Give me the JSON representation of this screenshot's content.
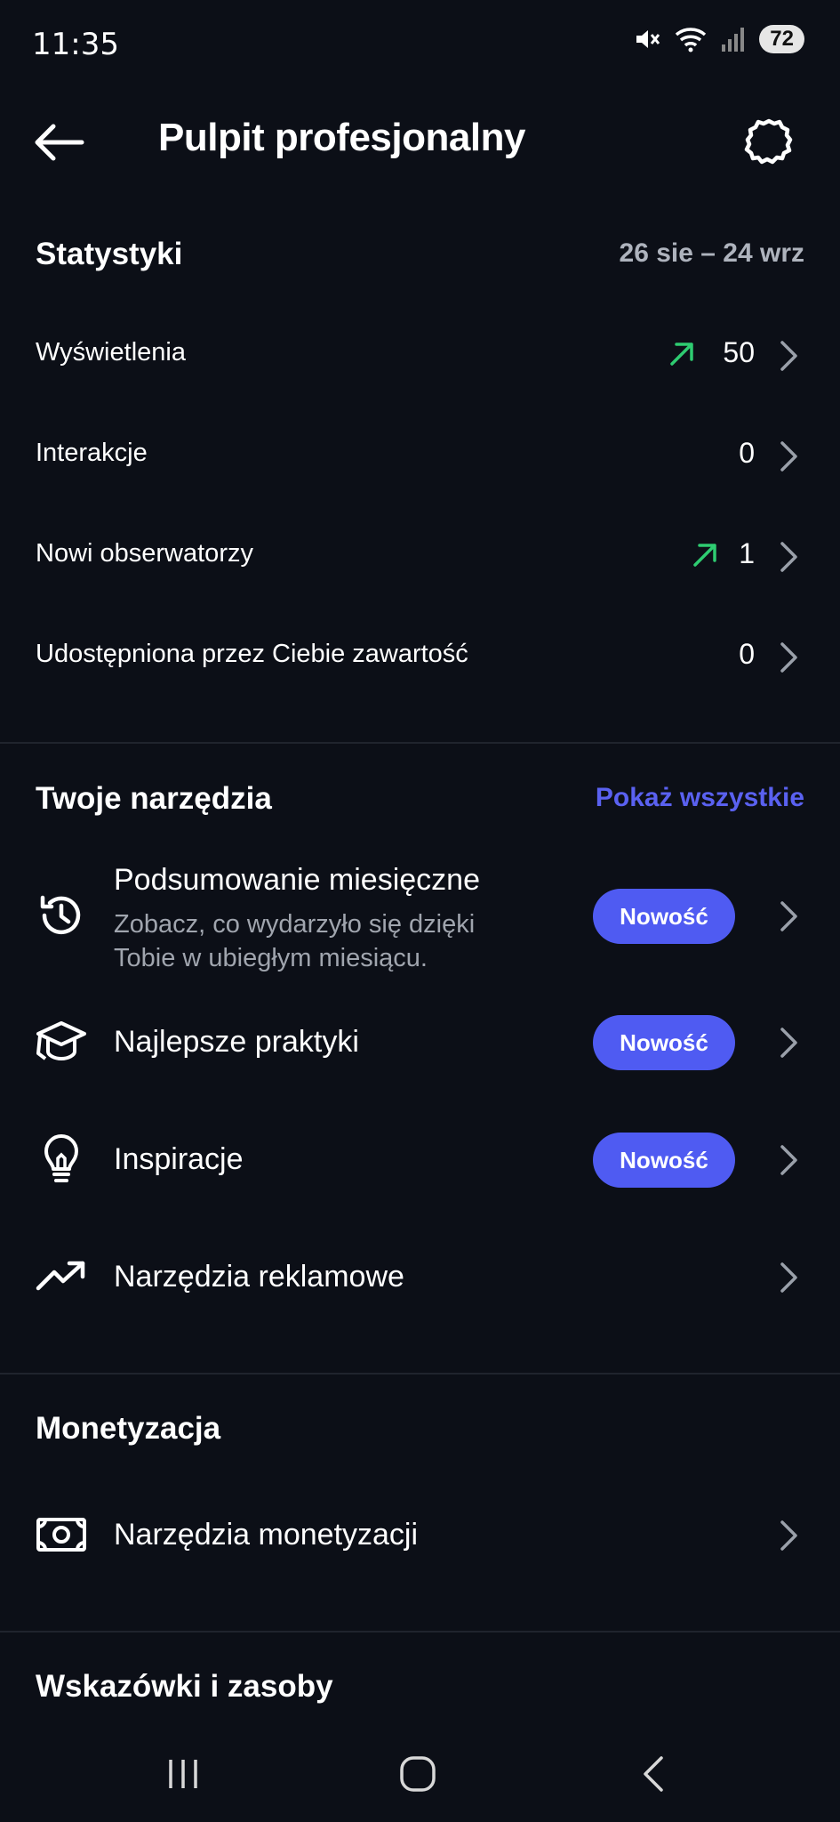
{
  "status_bar": {
    "time": "11:35",
    "battery": "72",
    "icons": [
      "mute-icon",
      "wifi-icon",
      "signal-icon",
      "battery-icon"
    ]
  },
  "header": {
    "title": "Pulpit profesjonalny",
    "back_icon": "arrow-left-icon",
    "settings_icon": "gear-icon"
  },
  "stats": {
    "heading": "Statystyki",
    "date_range": "26 sie – 24 wrz",
    "rows": [
      {
        "label": "Wyświetlenia",
        "value": "50",
        "trend": "up"
      },
      {
        "label": "Interakcje",
        "value": "0",
        "trend": ""
      },
      {
        "label": "Nowi obserwatorzy",
        "value": "1",
        "trend": "up"
      },
      {
        "label": "Udostępniona przez Ciebie zawartość",
        "value": "0",
        "trend": ""
      }
    ]
  },
  "tools": {
    "heading": "Twoje narzędzia",
    "show_all": "Pokaż wszystkie",
    "items": [
      {
        "title": "Podsumowanie miesięczne",
        "subtitle": "Zobacz, co wydarzyło się dzięki Tobie w ubiegłym miesiącu.",
        "badge": "Nowość",
        "icon": "history-icon"
      },
      {
        "title": "Najlepsze praktyki",
        "subtitle": "",
        "badge": "Nowość",
        "icon": "graduation-cap-icon"
      },
      {
        "title": "Inspiracje",
        "subtitle": "",
        "badge": "Nowość",
        "icon": "lightbulb-icon"
      },
      {
        "title": "Narzędzia reklamowe",
        "subtitle": "",
        "badge": "",
        "icon": "trending-up-icon"
      }
    ]
  },
  "monetization": {
    "heading": "Monetyzacja",
    "items": [
      {
        "title": "Narzędzia monetyzacji",
        "icon": "money-icon"
      }
    ]
  },
  "tips": {
    "heading": "Wskazówki i zasoby"
  },
  "colors": {
    "background": "#0c0f17",
    "accent": "#5a61f0",
    "badge": "#4f5bf2",
    "trend_up": "#2ecc71",
    "muted_text": "#a0a5ae"
  },
  "nav_bar": {
    "icons": [
      "recent-apps-icon",
      "home-icon",
      "back-nav-icon"
    ]
  }
}
